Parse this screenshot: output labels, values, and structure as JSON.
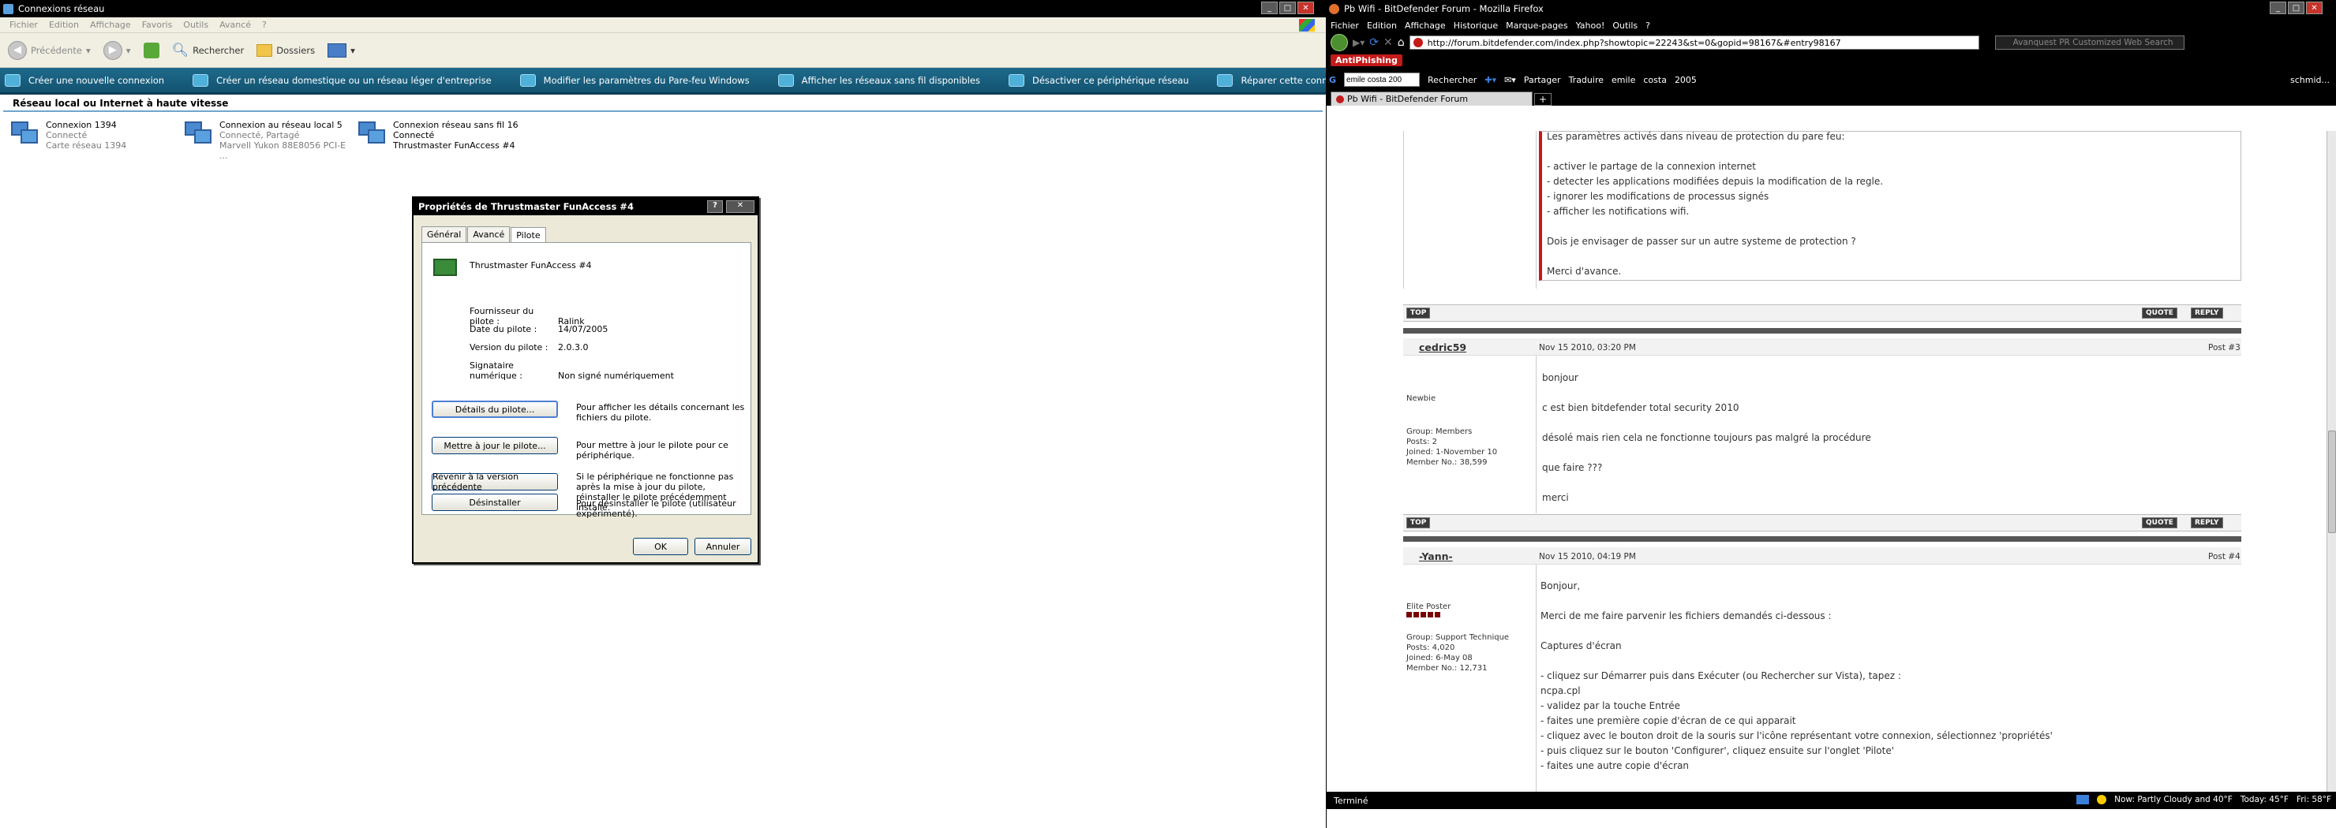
{
  "left": {
    "title": "Connexions réseau",
    "menu": [
      "Fichier",
      "Edition",
      "Affichage",
      "Favoris",
      "Outils",
      "Avancé",
      "?"
    ],
    "toolbar": {
      "back": "Précédente",
      "search": "Rechercher",
      "folders": "Dossiers"
    },
    "tasks": [
      "Créer une nouvelle connexion",
      "Créer un réseau domestique ou un réseau léger d'entreprise",
      "Modifier les paramètres du Pare-feu Windows",
      "Afficher les réseaux sans fil disponibles",
      "Désactiver ce périphérique réseau",
      "Réparer cette connexi..."
    ],
    "group_header": "Réseau local ou Internet à haute vitesse",
    "connections": [
      {
        "name": "Connexion 1394",
        "status": "Connecté",
        "device": "Carte réseau 1394"
      },
      {
        "name": "Connexion au réseau local 5",
        "status": "Connecté, Partagé",
        "device": "Marvell Yukon 88E8056 PCI-E ..."
      },
      {
        "name": "Connexion réseau sans fil 16",
        "status": "Connecté",
        "device": "Thrustmaster FunAccess #4"
      }
    ]
  },
  "dialog": {
    "title": "Propriétés de Thrustmaster FunAccess #4",
    "tabs": [
      "Général",
      "Avancé",
      "Pilote"
    ],
    "device_name": "Thrustmaster FunAccess #4",
    "fields": [
      {
        "k": "Fournisseur du pilote :",
        "v": "Ralink"
      },
      {
        "k": "Date du pilote :",
        "v": "14/07/2005"
      },
      {
        "k": "Version du pilote :",
        "v": "2.0.3.0"
      },
      {
        "k": "Signataire numérique :",
        "v": "Non signé numériquement"
      }
    ],
    "buttons": [
      {
        "label": "Détails du pilote...",
        "desc": "Pour afficher les détails concernant les fichiers du pilote."
      },
      {
        "label": "Mettre à jour le pilote...",
        "desc": "Pour mettre à jour le pilote pour ce périphérique."
      },
      {
        "label": "Revenir à la version précédente",
        "desc": "Si le périphérique ne fonctionne pas après la mise à jour du pilote, réinstaller le pilote précédemment installé."
      },
      {
        "label": "Désinstaller",
        "desc": "Pour désinstaller le pilote (utilisateur expérimenté)."
      }
    ],
    "ok": "OK",
    "cancel": "Annuler"
  },
  "right": {
    "title": "Pb Wifi - BitDefender Forum - Mozilla Firefox",
    "menu": [
      "Fichier",
      "Edition",
      "Affichage",
      "Historique",
      "Marque-pages",
      "Yahoo!",
      "Outils",
      "?"
    ],
    "url": "http://forum.bitdefender.com/index.php?showtopic=22243&st=0&gopid=98167&#entry98167",
    "search_placeholder": "Avanquest PR Customized Web Search",
    "antiphishing": "AntiPhishing",
    "google_query": "emile costa 200",
    "google_items": [
      "Rechercher",
      "Partager",
      "Traduire",
      "emile",
      "costa",
      "2005"
    ],
    "user": "schmid...",
    "tab": "Pb Wifi - BitDefender Forum",
    "quote_lines": [
      "Les paramètres activés dans niveau de protection du pare feu:",
      "- activer le partage de la connexion internet",
      "- detecter les applications modifiées depuis la modification de la regle.",
      "- ignorer les modifications de processus signés",
      "- afficher les notifications wifi.",
      "Dois je envisager de passer sur un autre systeme de protection ?",
      "Merci d'avance."
    ],
    "btn_top": "TOP",
    "btn_quote": "QUOTE",
    "btn_reply": "REPLY",
    "posts": [
      {
        "user": "cedric59",
        "rank": "Newbie",
        "group": "Group: Members",
        "posts": "Posts: 2",
        "joined": "Joined: 1-November 10",
        "member": "Member No.: 38,599",
        "date": "Nov 15 2010, 03:20 PM",
        "num": "Post #3",
        "lines": [
          "bonjour",
          "c est bien bitdefender total security 2010",
          "désolé mais rien cela ne fonctionne toujours pas malgré la procédure",
          "que faire ???",
          "merci"
        ]
      },
      {
        "user": "-Yann-",
        "rank": "Elite Poster",
        "group": "Group: Support Technique",
        "posts": "Posts: 4,020",
        "joined": "Joined: 6-May 08",
        "member": "Member No.: 12,731",
        "date": "Nov 15 2010, 04:19 PM",
        "num": "Post #4",
        "lines": [
          "Bonjour,",
          "Merci de me faire parvenir les fichiers demandés ci-dessous :",
          "Captures d'écran",
          "- cliquez sur Démarrer puis dans Exécuter (ou Rechercher sur Vista), tapez :",
          "ncpa.cpl",
          "- validez par la touche Entrée",
          "- faites une première copie d'écran de ce qui apparait",
          "- cliquez avec le bouton droit de la souris sur l'icône représentant votre connexion, sélectionnez 'propriétés'",
          "- puis cliquez sur le bouton 'Configurer', cliquez ensuite sur l'onglet 'Pilote'",
          "- faites une autre copie d'écran"
        ]
      }
    ],
    "status": "Terminé",
    "weather_now": "Now: Partly Cloudy and 40°F",
    "weather_today": "Today: 45°F",
    "weather_fri": "Fri: 58°F"
  }
}
